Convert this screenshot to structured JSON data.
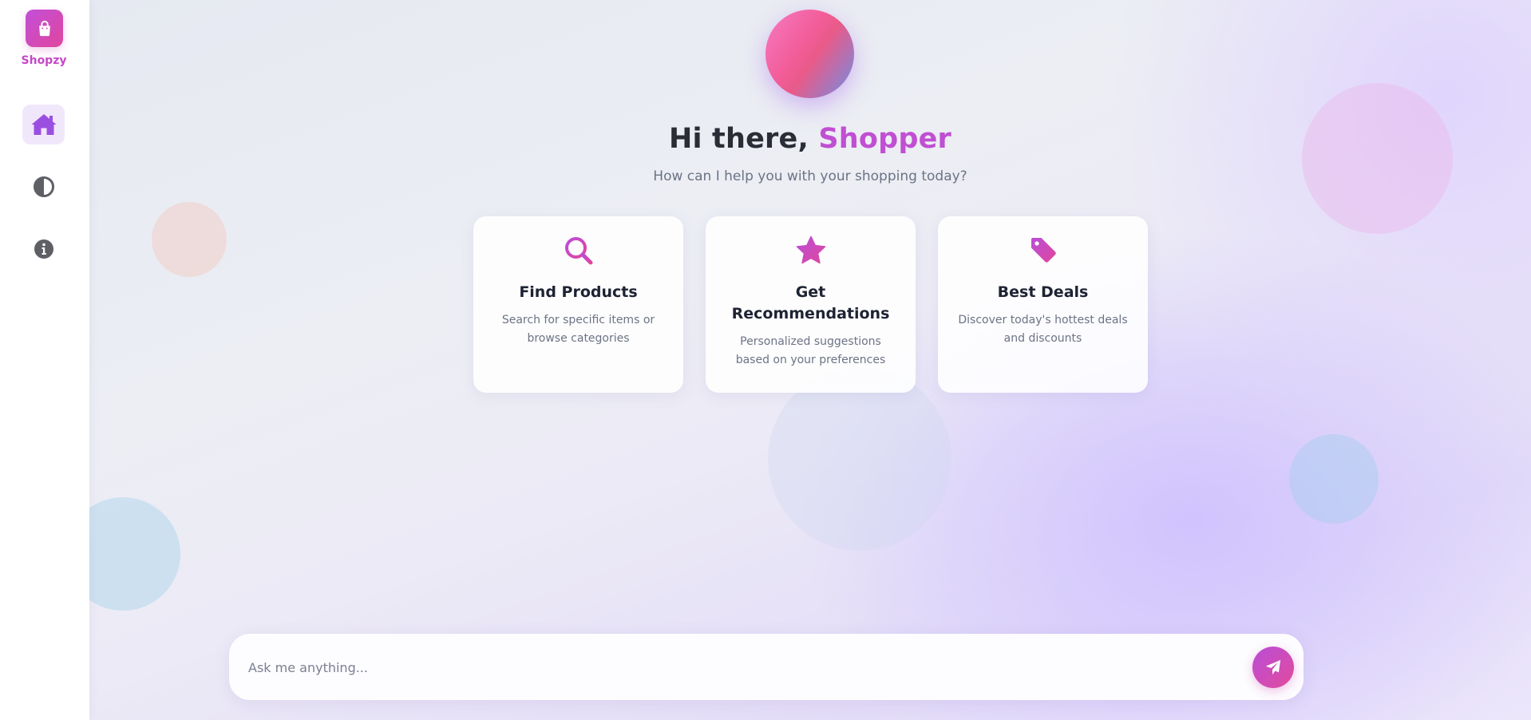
{
  "app": {
    "name": "Shopzy"
  },
  "sidebar": {
    "items": [
      {
        "icon": "home-icon",
        "active": true
      },
      {
        "icon": "contrast-icon",
        "active": false
      },
      {
        "icon": "info-icon",
        "active": false
      }
    ]
  },
  "hero": {
    "greeting_prefix": "Hi there, ",
    "greeting_name": "Shopper",
    "subtitle": "How can I help you with your shopping today?"
  },
  "cards": [
    {
      "icon": "search-icon",
      "title": "Find Products",
      "description": "Search for specific items or browse categories"
    },
    {
      "icon": "star-icon",
      "title": "Get Recommendations",
      "description": "Personalized suggestions based on your preferences"
    },
    {
      "icon": "tag-icon",
      "title": "Best Deals",
      "description": "Discover today's hottest deals and discounts"
    }
  ],
  "chat": {
    "placeholder": "Ask me anything...",
    "send_icon": "paper-plane-icon"
  },
  "colors": {
    "accent": "#c04fd2",
    "accent_gradient_end": "#e0469d",
    "active_nav_bg": "#f1e7fb",
    "home_icon": "#9b4fe0",
    "card_icon": "#c74fd0"
  }
}
